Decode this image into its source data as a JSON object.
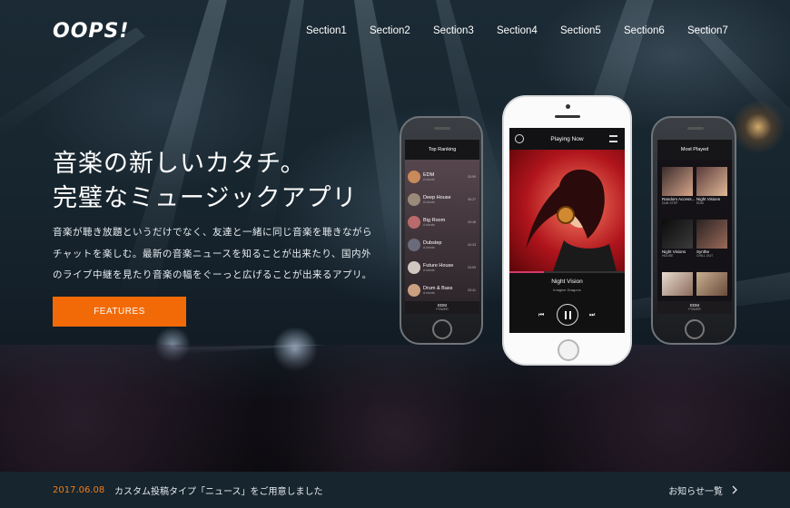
{
  "header": {
    "logo": "OOPS!",
    "nav": [
      "Section1",
      "Section2",
      "Section3",
      "Section4",
      "Section5",
      "Section6",
      "Section7"
    ]
  },
  "hero": {
    "headline_line1": "音楽の新しいカタチ。",
    "headline_line2": "完璧なミュージックアプリ",
    "desc_line1": "音楽が聴き放題というだけでなく、友達と一緒に同じ音楽を聴きながら",
    "desc_line2": "チャットを楽しむ。最新の音楽ニュースを知ることが出来たり、国内外",
    "desc_line3": "のライブ中継を見たり音楽の幅をぐーっと広げることが出来るアプリ。",
    "cta_label": "FEATURES"
  },
  "phone_left": {
    "title": "Top Ranking",
    "rows": [
      {
        "title": "EDM",
        "sub": "A shorts",
        "meta": "03:59"
      },
      {
        "title": "Deep House",
        "sub": "A shorts",
        "meta": "05:27"
      },
      {
        "title": "Big Room",
        "sub": "A shorts",
        "meta": "03:48"
      },
      {
        "title": "Dubstep",
        "sub": "A shorts",
        "meta": "04:33"
      },
      {
        "title": "Future House",
        "sub": "A shorts",
        "meta": "03:59"
      },
      {
        "title": "Drum & Bass",
        "sub": "A shorts",
        "meta": "03:41"
      }
    ],
    "footer_title": "EDM",
    "footer_sub": "POWER"
  },
  "phone_center": {
    "title": "Playing Now",
    "track": "Night Vision",
    "artist": "Imagine Dragons"
  },
  "phone_right": {
    "title": "Most Played",
    "items": [
      {
        "title": "Random Access...",
        "sub": "DUB STEP"
      },
      {
        "title": "Night Visions",
        "sub": "EDM"
      },
      {
        "title": "Night Visions",
        "sub": "HOUSE"
      },
      {
        "title": "Synthe",
        "sub": "CHILL OUT"
      },
      {
        "title": "",
        "sub": ""
      },
      {
        "title": "",
        "sub": ""
      }
    ],
    "footer_title": "EDM",
    "footer_sub": "POWER"
  },
  "news": {
    "date": "2017.06.08",
    "text": "カスタム投稿タイプ「ニュース」をご用意しました",
    "link_label": "お知らせ一覧",
    "link_icon": "chevron-right-icon"
  },
  "colors": {
    "accent": "#f26a08",
    "news_date": "#f07c1a",
    "news_bg": "#16252e"
  }
}
